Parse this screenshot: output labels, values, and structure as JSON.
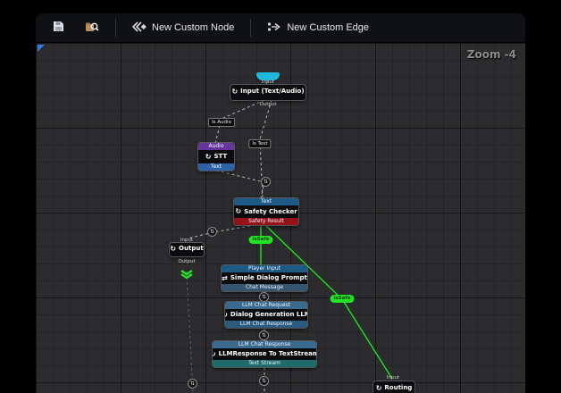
{
  "toolbar": {
    "new_node_label": "New Custom Node",
    "new_edge_label": "New Custom Edge"
  },
  "canvas": {
    "zoom_label": "Zoom -4"
  },
  "colors": {
    "safe_green": "#1ee41e",
    "exec_cyan": "#1fb8dc",
    "header_blue": "#1d5a86",
    "header_purple": "#67359c",
    "footer_red": "#96121a"
  },
  "icons": {
    "node": "↻",
    "dialog": "⇄",
    "edge_widget": "⇅",
    "save": "floppy-disk",
    "browse": "magnifier-box",
    "new_node": "double-chevron-diamond",
    "new_edge": "branch-arrow"
  },
  "nodes": {
    "input": {
      "pin_top": "Input",
      "title": "Input (Text/Audio)",
      "pin_bottom": "Output"
    },
    "stt": {
      "header": "Audio",
      "title": "STT",
      "footer": "Text"
    },
    "safety_checker": {
      "header": "Text",
      "title": "Safety Checker",
      "footer": "Safety Result"
    },
    "output": {
      "pin_top": "Input",
      "title": "Output",
      "pin_bottom": "Output"
    },
    "simple_dialog_prompt": {
      "header": "Player Input",
      "title": "Simple Dialog Prompt",
      "footer": "Chat Message"
    },
    "dialog_generation_llm": {
      "header": "LLM Chat Request",
      "title": "Dialog Generation LLM",
      "footer": "LLM Chat Response"
    },
    "llm_response_to_textstream": {
      "header": "LLM Chat Response",
      "title": "LLMResponse To TextStream",
      "footer": "Text Stream"
    },
    "routing": {
      "pin_top": "Input",
      "title": "Routing"
    }
  },
  "edge_labels": {
    "is_audio": "Is Audio",
    "is_text": "Is Text",
    "is_safe_1": "isSafe",
    "is_safe_2": "isSafe"
  }
}
